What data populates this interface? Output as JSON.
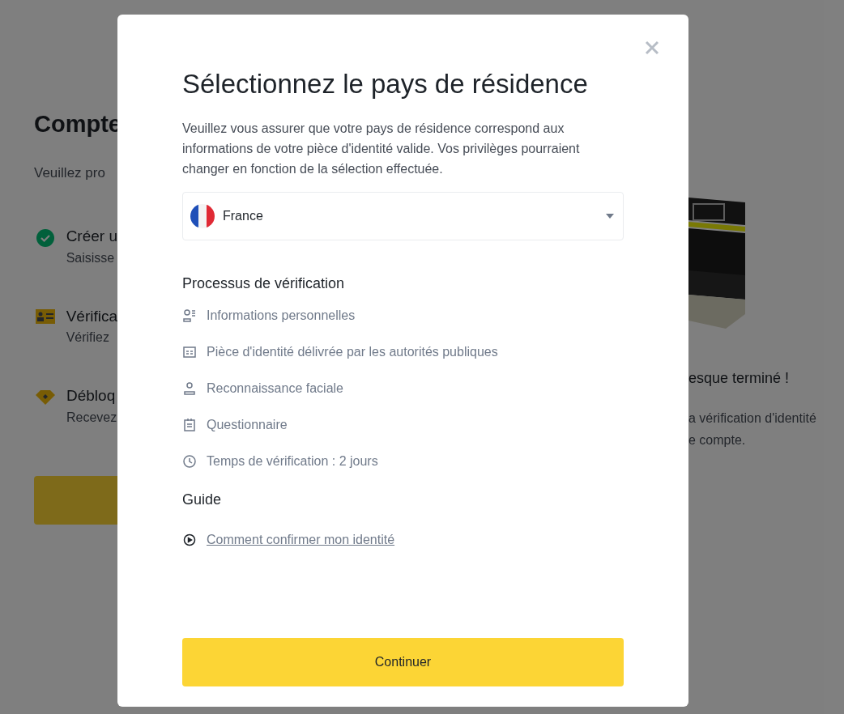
{
  "page": {
    "title": "Compte",
    "subtitle": "Veuillez pro",
    "steps": [
      {
        "kind": "done",
        "title": "Créer u",
        "subtitle": "Saisisse"
      },
      {
        "kind": "id",
        "title": "Vérifica",
        "subtitle": "Vérifiez"
      },
      {
        "kind": "reward",
        "title": "Débloq",
        "subtitle": "Recevez"
      }
    ],
    "side": {
      "title": "esque terminé !",
      "lines": [
        "a vérification d'identité",
        "e compte."
      ]
    }
  },
  "modal": {
    "title": "Sélectionnez le pays de résidence",
    "description": "Veuillez vous assurer que votre pays de résidence correspond aux informations de votre pièce d'identité valide. Vos privilèges pourraient changer en fonction de la sélection effectuée.",
    "country": {
      "value": "France"
    },
    "process_heading": "Processus de vérification",
    "process": [
      {
        "kind": "person-list",
        "label": "Informations personnelles"
      },
      {
        "kind": "id-card",
        "label": "Pièce d'identité délivrée par les autorités publiques"
      },
      {
        "kind": "person",
        "label": "Reconnaissance faciale"
      },
      {
        "kind": "clipboard",
        "label": "Questionnaire"
      },
      {
        "kind": "clock",
        "label": "Temps de vérification : 2 jours"
      }
    ],
    "guide_heading": "Guide",
    "guide_links": [
      {
        "kind": "video",
        "label": "Comment confirmer mon identité"
      }
    ],
    "button": "Continuer"
  }
}
